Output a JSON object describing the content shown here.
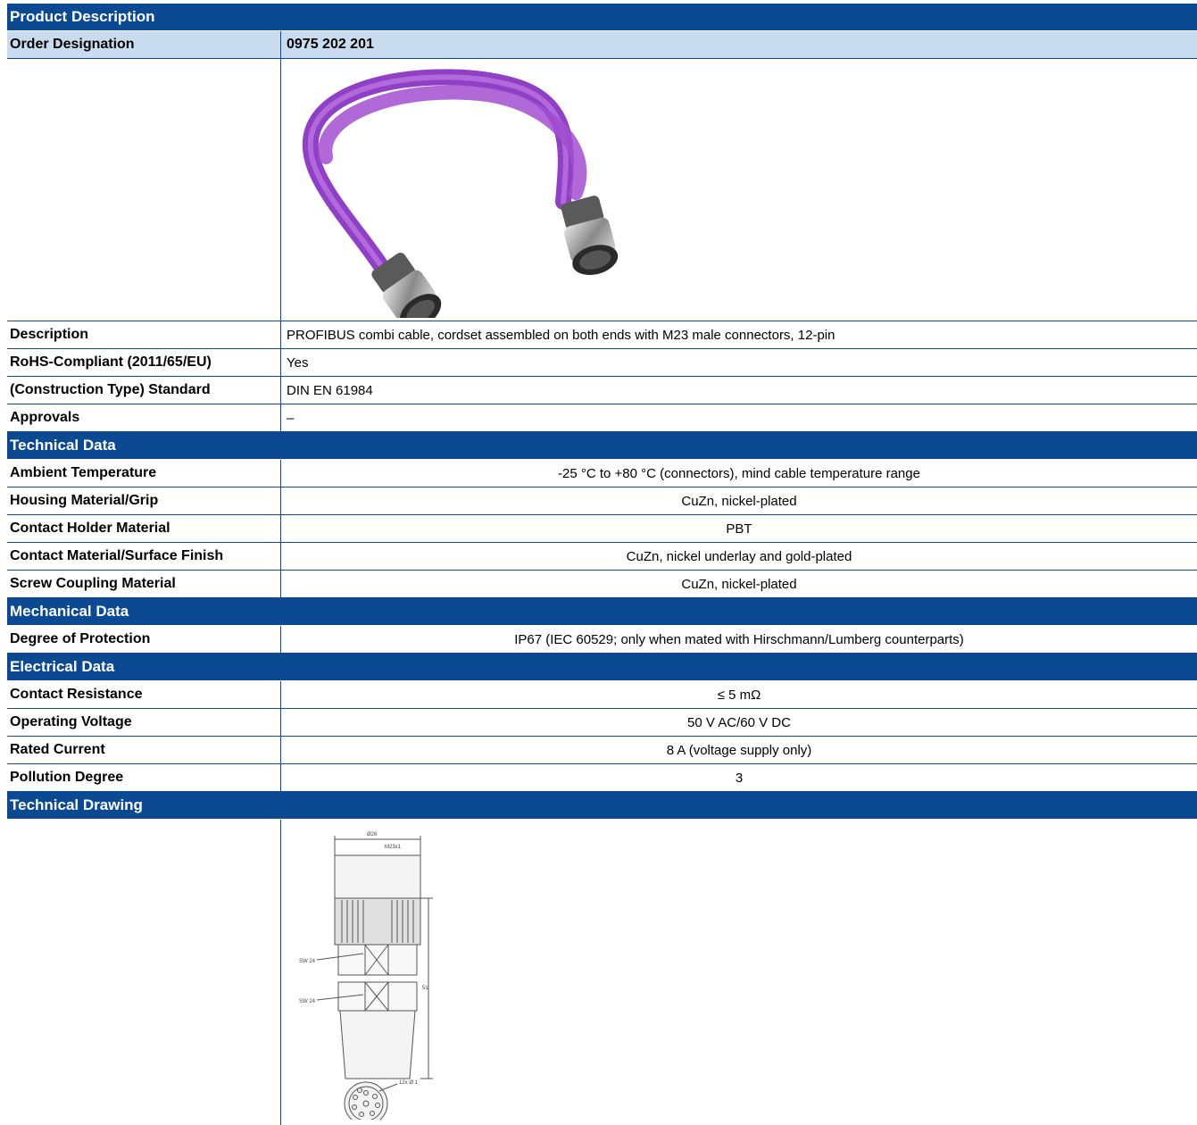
{
  "header": {
    "section_title": "Product Description",
    "order_label": "Order Designation",
    "order_value": "0975 202 201"
  },
  "product": {
    "image_name": "profibus-combi-cable-photo",
    "colors": {
      "cable": "#a24fd0",
      "header_blue": "#0b4a92",
      "subheader_blue": "#c9dcef"
    }
  },
  "description_rows": [
    {
      "label": "Description",
      "value": "PROFIBUS combi cable, cordset assembled on both ends with M23 male connectors, 12-pin"
    },
    {
      "label": "RoHS-Compliant (2011/65/EU)",
      "value": "Yes"
    },
    {
      "label": "(Construction Type) Standard",
      "value": "DIN EN 61984"
    },
    {
      "label": "Approvals",
      "value": "–"
    }
  ],
  "technical": {
    "title": "Technical Data",
    "rows": [
      {
        "label": "Ambient Temperature",
        "value": "-25 °C to +80 °C (connectors), mind cable temperature range"
      },
      {
        "label": "Housing Material/Grip",
        "value": "CuZn, nickel-plated"
      },
      {
        "label": "Contact Holder Material",
        "value": "PBT"
      },
      {
        "label": "Contact Material/Surface Finish",
        "value": "CuZn, nickel underlay and gold-plated"
      },
      {
        "label": "Screw Coupling Material",
        "value": "CuZn, nickel-plated"
      }
    ]
  },
  "mechanical": {
    "title": "Mechanical Data",
    "rows": [
      {
        "label": "Degree of Protection",
        "value": "IP67 (IEC 60529; only when mated with Hirschmann/Lumberg counterparts)"
      }
    ]
  },
  "electrical": {
    "title": "Electrical Data",
    "rows": [
      {
        "label": "Contact Resistance",
        "value": "≤ 5 mΩ"
      },
      {
        "label": "Operating Voltage",
        "value": "50 V AC/60 V DC"
      },
      {
        "label": "Rated Current",
        "value": "8 A (voltage supply only)"
      },
      {
        "label": "Pollution Degree",
        "value": "3"
      }
    ]
  },
  "drawing": {
    "title": "Technical Drawing",
    "labels": {
      "dia_top": "Ø26",
      "thread": "M23x1",
      "sw1": "SW 24",
      "sw2": "SW 24",
      "length": "51",
      "pins": "12x Ø 1"
    }
  }
}
